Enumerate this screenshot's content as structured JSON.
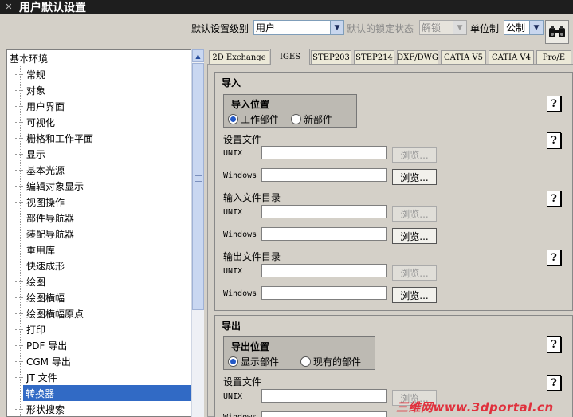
{
  "window": {
    "title": "用户默认设置"
  },
  "toolbar": {
    "level_label": "默认设置级别",
    "level_value": "用户",
    "lock_label": "默认的锁定状态",
    "lock_value": "解锁",
    "unit_label": "单位制",
    "unit_value": "公制"
  },
  "tree": {
    "items": [
      {
        "label": "基本环境"
      },
      {
        "label": "常规"
      },
      {
        "label": "对象"
      },
      {
        "label": "用户界面"
      },
      {
        "label": "可视化"
      },
      {
        "label": "栅格和工作平面"
      },
      {
        "label": "显示"
      },
      {
        "label": "基本光源"
      },
      {
        "label": "编辑对象显示"
      },
      {
        "label": "视图操作"
      },
      {
        "label": "部件导航器"
      },
      {
        "label": "装配导航器"
      },
      {
        "label": "重用库"
      },
      {
        "label": "快速成形"
      },
      {
        "label": "绘图"
      },
      {
        "label": "绘图横幅"
      },
      {
        "label": "绘图横幅原点"
      },
      {
        "label": "打印"
      },
      {
        "label": "PDF 导出"
      },
      {
        "label": "CGM 导出"
      },
      {
        "label": "JT 文件"
      },
      {
        "label": "转换器"
      },
      {
        "label": "形状搜索"
      }
    ]
  },
  "tabs": [
    {
      "label": "2D Exchange"
    },
    {
      "label": "IGES"
    },
    {
      "label": "STEP203"
    },
    {
      "label": "STEP214"
    },
    {
      "label": "DXF/DWG"
    },
    {
      "label": "CATIA V5"
    },
    {
      "label": "CATIA V4"
    },
    {
      "label": "Pro/E"
    }
  ],
  "import": {
    "title": "导入",
    "location_title": "导入位置",
    "radio_work": "工作部件",
    "radio_new": "新部件",
    "settings_file": "设置文件",
    "input_dir": "输入文件目录",
    "output_dir": "输出文件目录"
  },
  "export": {
    "title": "导出",
    "location_title": "导出位置",
    "radio_display": "显示部件",
    "radio_existing": "现有的部件",
    "settings_file": "设置文件"
  },
  "common": {
    "unix": "UNIX",
    "windows": "Windows",
    "browse": "浏览...",
    "help": "?"
  },
  "watermark": {
    "text": "三维网www.3dportal.cn"
  }
}
